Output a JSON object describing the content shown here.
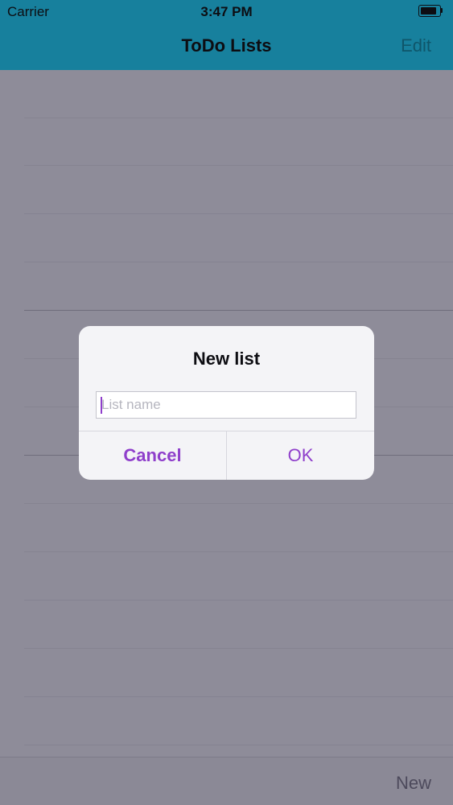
{
  "status_bar": {
    "carrier": "Carrier",
    "time": "3:47 PM",
    "battery_icon": "battery-icon",
    "battery_level": 0.85
  },
  "nav": {
    "title": "ToDo Lists",
    "edit_label": "Edit"
  },
  "table": {
    "row_count": 14
  },
  "toolbar": {
    "new_label": "New"
  },
  "alert": {
    "title": "New list",
    "input": {
      "value": "",
      "placeholder": "List name"
    },
    "cancel_label": "Cancel",
    "ok_label": "OK"
  },
  "colors": {
    "nav_background": "#17809d",
    "dim_overlay": "#8e8c99",
    "accent": "#8f3fcb",
    "alert_background": "#f4f4f7"
  }
}
